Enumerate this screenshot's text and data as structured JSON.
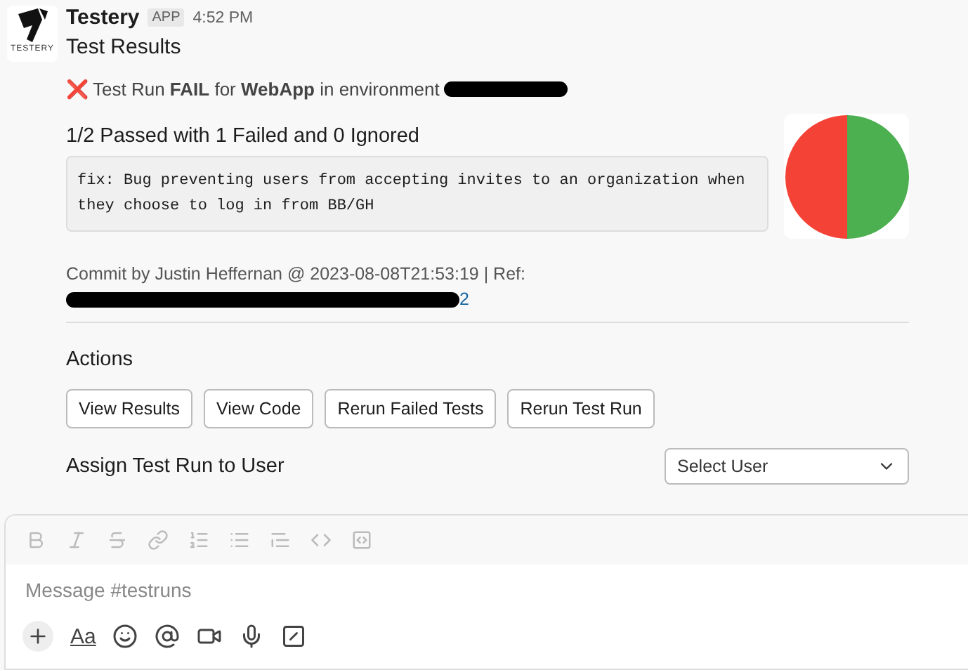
{
  "message": {
    "sender": "Testery",
    "badge": "APP",
    "time": "4:52 PM",
    "avatar_label": "TESTERY",
    "title": "Test Results"
  },
  "status": {
    "icon": "❌",
    "text": "Test Run **FAIL** for **WebApp** in environment"
  },
  "summary": "1/2 Passed with 1 Failed and 0 Ignored",
  "commit_message": "fix: Bug preventing users from accepting invites to an organization when they choose to log in from BB/GH",
  "chart_data": {
    "type": "pie",
    "series": [
      {
        "values": [
          50,
          50
        ]
      }
    ],
    "colors": [
      "#f44336",
      "#4caf50"
    ]
  },
  "commit": {
    "text": "Commit by Justin Heffernan @ 2023-08-08T21:53:19 | Ref:",
    "ref_tail": "2"
  },
  "actions": {
    "heading": "Actions",
    "buttons": [
      "View Results",
      "View Code",
      "Rerun Failed Tests",
      "Rerun Test Run"
    ]
  },
  "assign": {
    "label": "Assign Test Run to User",
    "select_placeholder": "Select User"
  },
  "composer": {
    "placeholder": "Message #testruns",
    "format_tools": [
      {
        "kind": "bold"
      },
      {
        "kind": "italic"
      },
      {
        "kind": "strike"
      },
      {
        "kind": "link"
      },
      {
        "kind": "ordered-list"
      },
      {
        "kind": "bullet-list"
      },
      {
        "kind": "quote"
      },
      {
        "kind": "code"
      },
      {
        "kind": "code-block"
      }
    ],
    "action_tools": [
      {
        "kind": "plus"
      },
      {
        "kind": "text",
        "label": "Aa"
      },
      {
        "kind": "emoji"
      },
      {
        "kind": "mention"
      },
      {
        "kind": "video"
      },
      {
        "kind": "mic"
      },
      {
        "kind": "slash"
      }
    ]
  }
}
